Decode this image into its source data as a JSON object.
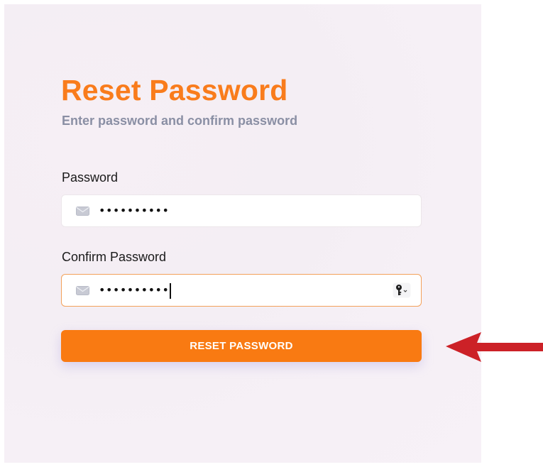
{
  "header": {
    "title": "Reset Password",
    "subtitle": "Enter password and confirm password"
  },
  "form": {
    "password": {
      "label": "Password",
      "masked_value": "••••••••••",
      "icon": "mail-icon"
    },
    "confirm_password": {
      "label": "Confirm Password",
      "masked_value": "••••••••••",
      "icon": "mail-icon",
      "focused": true,
      "autofill_icon": "key-icon"
    },
    "submit_label": "RESET PASSWORD"
  },
  "colors": {
    "accent": "#f97a12",
    "title": "#f97c1c",
    "subtitle": "#8a8fa4",
    "focus_border": "#f3a15a",
    "annotation_arrow": "#cc2127"
  },
  "annotation": {
    "icon": "red-arrow-left"
  }
}
